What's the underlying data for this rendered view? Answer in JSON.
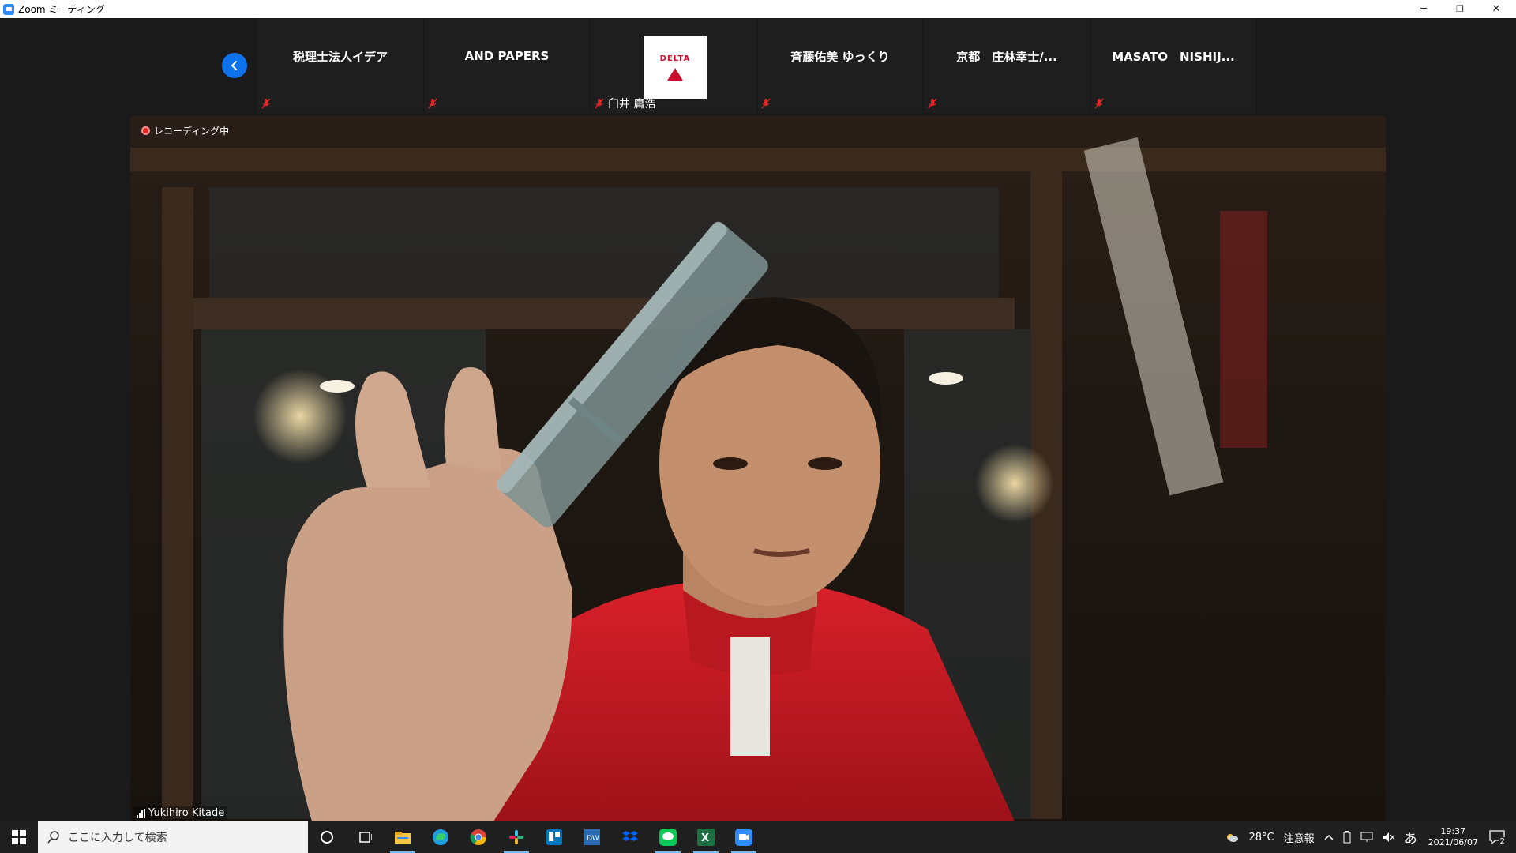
{
  "window": {
    "title": "Zoom ミーティング",
    "minimize": "─",
    "restore": "❐",
    "close": "✕"
  },
  "participants_strip": [
    {
      "name": "税理士法人イデア",
      "muted": true
    },
    {
      "name": "AND PAPERS",
      "muted": true
    },
    {
      "name": "臼井 庸浩",
      "muted": true,
      "logo_text": "DELTA",
      "logo_color": "#c8102e"
    },
    {
      "name": "斉藤佑美 ゆっくり",
      "muted": true
    },
    {
      "name": "京都　庄林幸士/...",
      "muted": true
    },
    {
      "name": "MASATO　NISHIJ...",
      "muted": true
    }
  ],
  "main_video": {
    "recording_label": "レコーディング中",
    "speaker_name": "Yukihiro Kitade"
  },
  "taskbar": {
    "search_placeholder": "ここに入力して検索",
    "apps": [
      "cortana-icon",
      "task-view-icon",
      "file-explorer-icon",
      "edge-icon",
      "chrome-icon",
      "slack-icon",
      "trello-icon",
      "dreamweaver-icon",
      "dropbox-icon",
      "line-icon",
      "excel-icon",
      "zoom-icon"
    ],
    "weather_temp": "28°C",
    "weather_alert": "注意報",
    "ime": "あ",
    "time": "19:37",
    "date": "2021/06/07",
    "notifications": "2"
  },
  "colors": {
    "accent": "#0e72ed",
    "zoom_blue": "#2d8cff",
    "muted_red": "#e02828"
  }
}
